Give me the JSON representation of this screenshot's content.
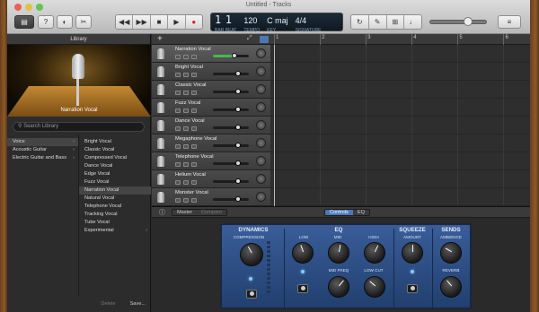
{
  "window": {
    "title": "Untitled - Tracks"
  },
  "toolbar": {
    "library_btn": "▤",
    "help_btn": "?",
    "smart_btn": "◐",
    "editors_btn": "✂",
    "transport": [
      "◀◀",
      "▶▶",
      "■",
      "▶",
      "●"
    ],
    "lcd": {
      "position_bar": "1",
      "position_beat": "1",
      "bar_label": "BAR",
      "beat_label": "BEAT",
      "tempo": "120",
      "tempo_label": "TEMPO",
      "key": "C maj",
      "time_sig": "4/4",
      "key_label": "KEY",
      "sig_label": "SIGNATURE"
    },
    "tools": [
      "↻",
      "✎",
      "⊞",
      "♩"
    ],
    "volume_level": 0.65
  },
  "library": {
    "header": "Library",
    "image_caption": "Narration Vocal",
    "search_placeholder": "Search Library",
    "categories": [
      {
        "label": "Voice",
        "selected": true
      },
      {
        "label": "Acoustic Guitar",
        "selected": false
      },
      {
        "label": "Electric Guitar and Bass",
        "selected": false
      }
    ],
    "patches": [
      "Bright Vocal",
      "Classic Vocal",
      "Compressed Vocal",
      "Dance Vocal",
      "Edge Vocal",
      "Fuzz Vocal",
      "Narration Vocal",
      "Natural Vocal",
      "Telephone Vocal",
      "Tracking Vocal",
      "Tube Vocal",
      "Experimental"
    ],
    "selected_patch": "Narration Vocal",
    "delete_label": "Delete",
    "save_label": "Save..."
  },
  "tracks": [
    {
      "name": "Narration Vocal",
      "selected": true,
      "volume": 0.6
    },
    {
      "name": "Bright Vocal",
      "selected": false,
      "volume": 0.7
    },
    {
      "name": "Classic Vocal",
      "selected": false,
      "volume": 0.7
    },
    {
      "name": "Fuzz Vocal",
      "selected": false,
      "volume": 0.7
    },
    {
      "name": "Dance Vocal",
      "selected": false,
      "volume": 0.7
    },
    {
      "name": "Megaphone Vocal",
      "selected": false,
      "volume": 0.7
    },
    {
      "name": "Telephone Vocal",
      "selected": false,
      "volume": 0.7
    },
    {
      "name": "Helium Vocal",
      "selected": false,
      "volume": 0.7
    },
    {
      "name": "Monster Vocal",
      "selected": false,
      "volume": 0.7
    }
  ],
  "ruler": [
    "1",
    "2",
    "3",
    "4",
    "5",
    "6"
  ],
  "smart_controls": {
    "master_tab": "Master",
    "compare_tab": "Compare",
    "controls_tab": "Controls",
    "eq_tab": "EQ",
    "sections": {
      "dynamics": "DYNAMICS",
      "eq": "EQ",
      "squeeze": "SQUEEZE",
      "sends": "SENDS"
    },
    "knob_labels": {
      "compression": "COMPRESSION",
      "low": "LOW",
      "mid": "MID",
      "high": "HIGH",
      "mid_freq": "MID FREQ",
      "low_cut": "LOW CUT",
      "amount": "AMOUNT",
      "ambience": "AMBIENCE",
      "reverb": "REVERB"
    }
  }
}
